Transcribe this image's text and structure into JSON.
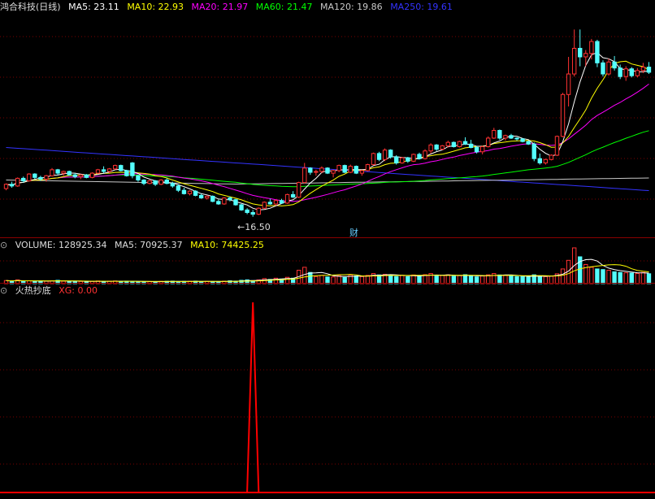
{
  "price_header": {
    "title": "鸿合科技(日线)",
    "ma5": "MA5: 23.11",
    "ma10": "MA10: 22.93",
    "ma20": "MA20: 21.97",
    "ma60": "MA60: 21.47",
    "ma120": "MA120: 19.86",
    "ma250": "MA250: 19.61"
  },
  "price_annotations": {
    "low_label": "16.50",
    "event_marker": "财"
  },
  "volume_header": {
    "volume": "VOLUME: 128925.34",
    "ma5": "MA5: 70925.37",
    "ma10": "MA10: 74425.25"
  },
  "indicator_header": {
    "name": "火热抄底",
    "xg": "XG: 0.00"
  },
  "colors": {
    "up": "#ff3232",
    "down": "#54ffff",
    "ma5": "#ffffff",
    "ma10": "#ffff00",
    "ma20": "#ff00ff",
    "ma60": "#00ff00",
    "ma120": "#c8c8c8",
    "ma250": "#3333ff",
    "grid": "#7a0000",
    "signal": "#ff0000"
  },
  "chart_data": {
    "type": "candlestick",
    "low_price": 16.5,
    "candles": [
      [
        19.8,
        20.4,
        19.6,
        20.3
      ],
      [
        20.3,
        20.6,
        19.9,
        20.1
      ],
      [
        20.1,
        21.1,
        20.0,
        21.0
      ],
      [
        21.0,
        21.2,
        20.5,
        20.7
      ],
      [
        20.7,
        21.6,
        20.6,
        21.5
      ],
      [
        21.5,
        21.6,
        20.9,
        21.1
      ],
      [
        21.1,
        21.3,
        20.7,
        20.9
      ],
      [
        20.9,
        21.4,
        20.6,
        21.3
      ],
      [
        21.3,
        22.2,
        21.2,
        22.0
      ],
      [
        22.0,
        22.1,
        21.4,
        21.6
      ],
      [
        21.6,
        21.9,
        21.3,
        21.8
      ],
      [
        21.8,
        21.9,
        21.3,
        21.4
      ],
      [
        21.4,
        21.6,
        21.0,
        21.2
      ],
      [
        21.2,
        21.5,
        20.9,
        21.4
      ],
      [
        21.4,
        21.5,
        21.0,
        21.1
      ],
      [
        21.1,
        21.7,
        21.0,
        21.6
      ],
      [
        21.6,
        22.1,
        21.5,
        22.0
      ],
      [
        22.0,
        22.4,
        21.6,
        21.8
      ],
      [
        21.8,
        22.2,
        21.6,
        22.1
      ],
      [
        22.1,
        22.6,
        22.0,
        22.5
      ],
      [
        22.5,
        22.6,
        21.8,
        21.9
      ],
      [
        21.9,
        22.0,
        21.2,
        21.3
      ],
      [
        22.8,
        22.9,
        21.0,
        21.3
      ],
      [
        21.3,
        21.4,
        20.6,
        20.8
      ],
      [
        20.8,
        20.9,
        20.2,
        20.4
      ],
      [
        20.4,
        20.8,
        20.3,
        20.7
      ],
      [
        20.7,
        20.8,
        20.1,
        20.3
      ],
      [
        20.3,
        20.9,
        20.2,
        20.8
      ],
      [
        20.8,
        21.0,
        20.3,
        20.4
      ],
      [
        20.4,
        20.6,
        19.9,
        20.1
      ],
      [
        20.1,
        20.3,
        19.4,
        19.6
      ],
      [
        19.6,
        19.9,
        19.1,
        19.2
      ],
      [
        19.2,
        19.6,
        19.0,
        19.5
      ],
      [
        19.5,
        19.6,
        18.9,
        19.0
      ],
      [
        19.0,
        19.2,
        18.6,
        18.7
      ],
      [
        18.7,
        19.0,
        18.5,
        18.9
      ],
      [
        18.9,
        19.0,
        18.2,
        18.3
      ],
      [
        18.3,
        18.5,
        17.9,
        18.0
      ],
      [
        18.0,
        18.8,
        17.9,
        18.7
      ],
      [
        18.7,
        18.9,
        18.3,
        18.5
      ],
      [
        18.5,
        18.6,
        17.8,
        17.9
      ],
      [
        17.9,
        18.0,
        17.2,
        17.3
      ],
      [
        17.3,
        17.5,
        16.8,
        17.0
      ],
      [
        17.0,
        17.3,
        16.5,
        16.8
      ],
      [
        16.8,
        17.6,
        16.7,
        17.5
      ],
      [
        17.5,
        18.3,
        17.4,
        18.2
      ],
      [
        18.2,
        18.6,
        17.9,
        18.0
      ],
      [
        18.0,
        18.5,
        17.8,
        18.4
      ],
      [
        18.4,
        18.6,
        18.0,
        18.1
      ],
      [
        18.1,
        19.2,
        18.0,
        19.1
      ],
      [
        19.1,
        19.5,
        18.7,
        18.8
      ],
      [
        18.8,
        20.6,
        18.7,
        20.5
      ],
      [
        20.5,
        22.8,
        20.4,
        22.2
      ],
      [
        22.2,
        22.3,
        21.4,
        21.7
      ],
      [
        21.7,
        22.0,
        21.3,
        21.8
      ],
      [
        21.8,
        22.4,
        21.6,
        22.2
      ],
      [
        22.2,
        22.3,
        21.5,
        21.6
      ],
      [
        21.6,
        22.0,
        21.1,
        21.9
      ],
      [
        21.9,
        22.6,
        21.7,
        22.5
      ],
      [
        22.5,
        22.6,
        21.6,
        21.7
      ],
      [
        21.7,
        22.6,
        21.6,
        22.4
      ],
      [
        22.4,
        22.5,
        21.5,
        21.6
      ],
      [
        21.6,
        22.0,
        21.3,
        21.9
      ],
      [
        21.9,
        22.7,
        21.8,
        22.6
      ],
      [
        22.6,
        24.0,
        22.5,
        23.9
      ],
      [
        23.9,
        24.1,
        23.0,
        23.2
      ],
      [
        23.2,
        24.5,
        23.0,
        24.3
      ],
      [
        24.3,
        24.4,
        23.3,
        23.5
      ],
      [
        23.5,
        23.7,
        22.6,
        22.8
      ],
      [
        22.8,
        23.5,
        22.7,
        23.4
      ],
      [
        23.4,
        23.5,
        22.8,
        23.0
      ],
      [
        23.0,
        23.9,
        22.9,
        23.8
      ],
      [
        23.8,
        24.0,
        23.2,
        23.3
      ],
      [
        23.3,
        24.4,
        23.2,
        24.2
      ],
      [
        24.2,
        25.1,
        23.9,
        24.9
      ],
      [
        24.9,
        25.0,
        24.2,
        24.4
      ],
      [
        24.4,
        24.9,
        24.3,
        24.8
      ],
      [
        24.8,
        25.4,
        24.6,
        25.2
      ],
      [
        25.2,
        25.3,
        24.6,
        24.7
      ],
      [
        24.7,
        25.4,
        24.6,
        25.3
      ],
      [
        25.3,
        25.8,
        24.9,
        25.0
      ],
      [
        25.0,
        25.5,
        24.5,
        24.6
      ],
      [
        24.6,
        24.8,
        23.9,
        24.1
      ],
      [
        24.1,
        24.8,
        23.8,
        24.7
      ],
      [
        24.7,
        25.9,
        24.6,
        25.7
      ],
      [
        25.7,
        26.9,
        25.6,
        26.6
      ],
      [
        26.6,
        26.7,
        25.5,
        25.7
      ],
      [
        25.7,
        26.1,
        25.4,
        26.0
      ],
      [
        26.0,
        26.2,
        25.6,
        25.7
      ],
      [
        25.7,
        25.8,
        25.4,
        25.6
      ],
      [
        25.6,
        25.7,
        25.2,
        25.3
      ],
      [
        25.3,
        25.4,
        24.9,
        25.0
      ],
      [
        25.0,
        25.2,
        23.0,
        23.3
      ],
      [
        23.3,
        23.9,
        22.6,
        22.8
      ],
      [
        22.8,
        23.3,
        22.6,
        23.2
      ],
      [
        23.2,
        23.8,
        23.1,
        23.7
      ],
      [
        23.7,
        26.0,
        23.6,
        25.9
      ],
      [
        25.9,
        31.0,
        25.8,
        30.8
      ],
      [
        30.8,
        35.2,
        29.4,
        33.2
      ],
      [
        33.2,
        38.4,
        32.9,
        36.2
      ],
      [
        36.2,
        38.4,
        34.1,
        35.2
      ],
      [
        35.2,
        36.0,
        34.1,
        35.6
      ],
      [
        35.6,
        37.3,
        34.9,
        37.0
      ],
      [
        37.0,
        37.2,
        34.0,
        34.5
      ],
      [
        34.5,
        34.8,
        32.9,
        33.2
      ],
      [
        33.2,
        35.0,
        33.0,
        34.6
      ],
      [
        34.6,
        35.3,
        33.6,
        33.9
      ],
      [
        33.9,
        34.3,
        32.6,
        32.9
      ],
      [
        32.9,
        34.1,
        32.4,
        33.8
      ],
      [
        33.8,
        34.0,
        32.8,
        33.0
      ],
      [
        33.0,
        33.9,
        32.8,
        33.6
      ],
      [
        33.6,
        34.5,
        33.3,
        34.0
      ],
      [
        34.0,
        34.6,
        33.2,
        33.4
      ]
    ],
    "volume": [
      48,
      39,
      59,
      33,
      44,
      39,
      44,
      39,
      44,
      52,
      39,
      37,
      33,
      35,
      29,
      35,
      42,
      33,
      39,
      42,
      37,
      39,
      33,
      31,
      29,
      31,
      29,
      35,
      37,
      39,
      33,
      35,
      37,
      39,
      29,
      35,
      31,
      33,
      39,
      44,
      39,
      52,
      59,
      46,
      59,
      79,
      66,
      85,
      72,
      99,
      85,
      210,
      256,
      175,
      111,
      129,
      105,
      105,
      125,
      96,
      136,
      119,
      110,
      129,
      158,
      136,
      145,
      138,
      110,
      129,
      110,
      136,
      119,
      140,
      158,
      119,
      128,
      138,
      116,
      129,
      140,
      119,
      105,
      119,
      138,
      158,
      136,
      129,
      119,
      110,
      110,
      105,
      138,
      119,
      110,
      119,
      154,
      230,
      365,
      560,
      420,
      300,
      256,
      230,
      220,
      210,
      185,
      175,
      170,
      165,
      160,
      175,
      155
    ],
    "signal": {
      "index": 43,
      "value": 1
    }
  }
}
